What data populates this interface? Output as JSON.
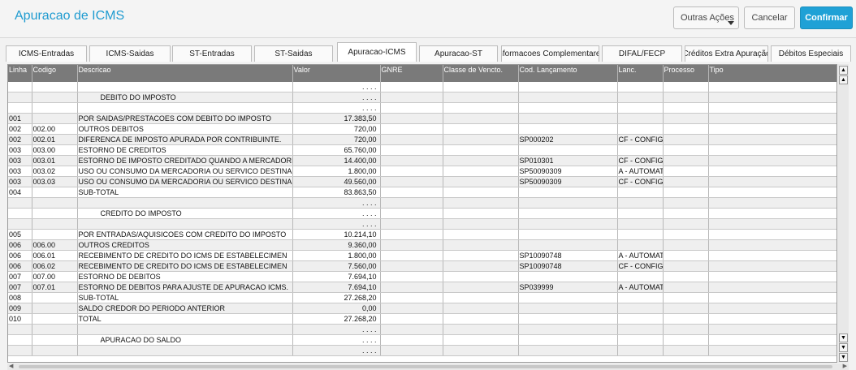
{
  "header": {
    "title": "Apuracao de ICMS",
    "outras_acoes": "Outras Ações",
    "cancelar": "Cancelar",
    "confirmar": "Confirmar"
  },
  "tabs": [
    {
      "label": "ICMS-Entradas",
      "active": false
    },
    {
      "label": "ICMS-Saidas",
      "active": false
    },
    {
      "label": "ST-Entradas",
      "active": false
    },
    {
      "label": "ST-Saidas",
      "active": false
    },
    {
      "label": "Apuracao-ICMS",
      "active": true
    },
    {
      "label": "Apuracao-ST",
      "active": false
    },
    {
      "label": "Informacoes Complementares",
      "active": false
    },
    {
      "label": "DIFAL/FECP",
      "active": false
    },
    {
      "label": "Créditos Extra Apuração",
      "active": false
    },
    {
      "label": "Débitos Especiais",
      "active": false
    }
  ],
  "grid": {
    "columns": [
      "Linha",
      "Codigo",
      "Descricao",
      "Valor",
      "GNRE",
      "Classe de Vencto.",
      "Cod. Lançamento",
      "Lanc.",
      "Processo",
      "Tipo"
    ],
    "rows": [
      [
        "",
        "",
        "",
        ". . . .",
        "",
        "",
        "",
        "",
        "",
        ""
      ],
      [
        "",
        "",
        "DEBITO DO IMPOSTO",
        ". . . .",
        "",
        "",
        "",
        "",
        "",
        ""
      ],
      [
        "",
        "",
        "",
        ". . . .",
        "",
        "",
        "",
        "",
        "",
        ""
      ],
      [
        "001",
        "",
        "POR SAIDAS/PRESTACOES COM DEBITO DO IMPOSTO",
        "17.383,50",
        "",
        "",
        "",
        "",
        "",
        ""
      ],
      [
        "002",
        "002.00",
        "OUTROS DEBITOS",
        "720,00",
        "",
        "",
        "",
        "",
        "",
        ""
      ],
      [
        "002",
        "002.01",
        "DIFERENCA DE IMPOSTO APURADA POR CONTRIBUINTE.",
        "720,00",
        "",
        "",
        "SP000202",
        "CF - CONFIG T",
        "",
        ""
      ],
      [
        "003",
        "003.00",
        "ESTORNO DE CREDITOS",
        "65.760,00",
        "",
        "",
        "",
        "",
        "",
        ""
      ],
      [
        "003",
        "003.01",
        "ESTORNO DE IMPOSTO CREDITADO QUANDO A MERCADORIA ENTRA",
        "14.400,00",
        "",
        "",
        "SP010301",
        "CF - CONFIG T",
        "",
        ""
      ],
      [
        "003",
        "003.02",
        "USO OU CONSUMO DA MERCADORIA OU SERVICO DESTINA",
        "1.800,00",
        "",
        "",
        "SP50090309",
        "A - AUTOMAT",
        "",
        ""
      ],
      [
        "003",
        "003.03",
        "USO OU CONSUMO DA MERCADORIA OU SERVICO DESTINA",
        "49.560,00",
        "",
        "",
        "SP50090309",
        "CF - CONFIG T",
        "",
        ""
      ],
      [
        "004",
        "",
        "SUB-TOTAL",
        "83.863,50",
        "",
        "",
        "",
        "",
        "",
        ""
      ],
      [
        "",
        "",
        "",
        ". . . .",
        "",
        "",
        "",
        "",
        "",
        ""
      ],
      [
        "",
        "",
        "CREDITO DO IMPOSTO",
        ". . . .",
        "",
        "",
        "",
        "",
        "",
        ""
      ],
      [
        "",
        "",
        "",
        ". . . .",
        "",
        "",
        "",
        "",
        "",
        ""
      ],
      [
        "005",
        "",
        "POR ENTRADAS/AQUISICOES COM CREDITO DO IMPOSTO",
        "10.214,10",
        "",
        "",
        "",
        "",
        "",
        ""
      ],
      [
        "006",
        "006.00",
        "OUTROS CREDITOS",
        "9.360,00",
        "",
        "",
        "",
        "",
        "",
        ""
      ],
      [
        "006",
        "006.01",
        "RECEBIMENTO DE CREDITO DO ICMS DE ESTABELECIMEN",
        "1.800,00",
        "",
        "",
        "SP10090748",
        "A - AUTOMAT",
        "",
        ""
      ],
      [
        "006",
        "006.02",
        "RECEBIMENTO DE CREDITO DO ICMS DE ESTABELECIMEN",
        "7.560,00",
        "",
        "",
        "SP10090748",
        "CF - CONFIG T",
        "",
        ""
      ],
      [
        "007",
        "007.00",
        "ESTORNO DE DEBITOS",
        "7.694,10",
        "",
        "",
        "",
        "",
        "",
        ""
      ],
      [
        "007",
        "007.01",
        "ESTORNO DE DEBITOS PARA AJUSTE DE APURACAO ICMS.",
        "7.694,10",
        "",
        "",
        "SP039999",
        "A - AUTOMAT",
        "",
        ""
      ],
      [
        "008",
        "",
        "SUB-TOTAL",
        "27.268,20",
        "",
        "",
        "",
        "",
        "",
        ""
      ],
      [
        "009",
        "",
        "SALDO CREDOR DO PERIODO ANTERIOR",
        "0,00",
        "",
        "",
        "",
        "",
        "",
        ""
      ],
      [
        "010",
        "",
        "TOTAL",
        "27.268,20",
        "",
        "",
        "",
        "",
        "",
        ""
      ],
      [
        "",
        "",
        "",
        ". . . .",
        "",
        "",
        "",
        "",
        "",
        ""
      ],
      [
        "",
        "",
        "APURACAO DO SALDO",
        ". . . .",
        "",
        "",
        "",
        "",
        "",
        ""
      ],
      [
        "",
        "",
        "",
        ". . . .",
        "",
        "",
        "",
        "",
        "",
        ""
      ]
    ]
  },
  "icons": {
    "scroll_top": "double-up-arrow-icon",
    "scroll_up": "up-arrow-icon",
    "scroll_down": "down-arrow-icon",
    "scroll_bottom": "double-down-arrow-icon"
  },
  "colors": {
    "title": "#1f9bd0",
    "confirm_button": "#1fa1d6",
    "grid_header": "#7a7a7a"
  }
}
